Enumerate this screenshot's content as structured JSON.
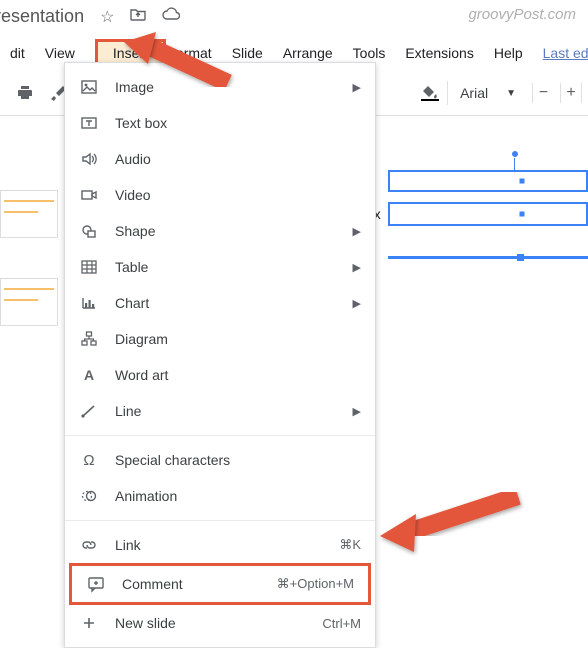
{
  "watermark": "groovyPost.com",
  "title": "d presentation",
  "menubar": {
    "items": [
      "dit",
      "View",
      "Insert",
      "ormat",
      "Slide",
      "Arrange",
      "Tools",
      "Extensions",
      "Help"
    ],
    "last_edit": "Last edit was sec"
  },
  "toolbar": {
    "font": "Arial"
  },
  "dropdown": {
    "items": [
      {
        "icon": "image-icon",
        "label": "Image",
        "submenu": true
      },
      {
        "icon": "textbox-icon",
        "label": "Text box"
      },
      {
        "icon": "audio-icon",
        "label": "Audio"
      },
      {
        "icon": "video-icon",
        "label": "Video"
      },
      {
        "icon": "shape-icon",
        "label": "Shape",
        "submenu": true
      },
      {
        "icon": "table-icon",
        "label": "Table",
        "submenu": true
      },
      {
        "icon": "chart-icon",
        "label": "Chart",
        "submenu": true
      },
      {
        "icon": "diagram-icon",
        "label": "Diagram"
      },
      {
        "icon": "wordart-icon",
        "label": "Word art"
      },
      {
        "icon": "line-icon",
        "label": "Line",
        "submenu": true
      }
    ],
    "section2": [
      {
        "icon": "special-icon",
        "label": "Special characters"
      },
      {
        "icon": "animation-icon",
        "label": "Animation"
      }
    ],
    "section3": [
      {
        "icon": "link-icon",
        "label": "Link",
        "shortcut": "⌘K"
      },
      {
        "icon": "comment-icon",
        "label": "Comment",
        "shortcut": "⌘+Option+M",
        "highlight": true
      },
      {
        "icon": "newslide-icon",
        "label": "New slide",
        "shortcut": "Ctrl+M"
      }
    ]
  },
  "canvas": {
    "box_label": "ox"
  }
}
